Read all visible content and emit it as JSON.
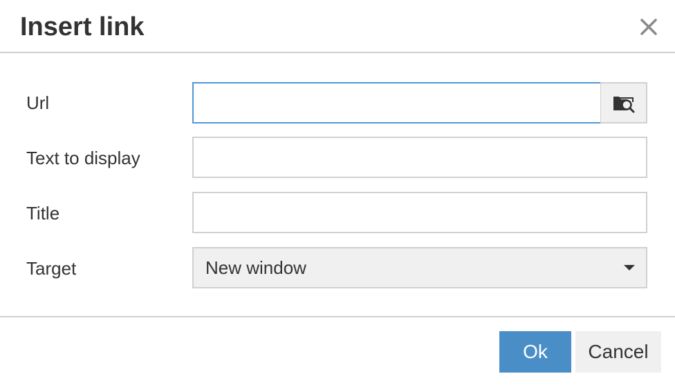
{
  "dialog": {
    "title": "Insert link",
    "close_icon": "close-icon"
  },
  "form": {
    "url": {
      "label": "Url",
      "value": "",
      "placeholder": "",
      "browse_icon": "folder-search-icon"
    },
    "text_to_display": {
      "label": "Text to display",
      "value": "",
      "placeholder": ""
    },
    "title": {
      "label": "Title",
      "value": "",
      "placeholder": ""
    },
    "target": {
      "label": "Target",
      "selected": "New window",
      "dropdown_icon": "caret-down-icon"
    }
  },
  "footer": {
    "ok_label": "Ok",
    "cancel_label": "Cancel"
  },
  "colors": {
    "primary": "#4a8ec8",
    "focus_border": "#4f97d6",
    "text": "#333333",
    "button_secondary_bg": "#f0f0f0"
  }
}
